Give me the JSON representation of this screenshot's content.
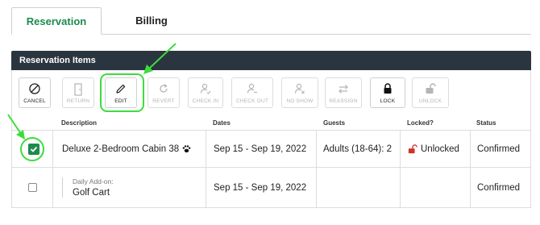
{
  "tabs": [
    {
      "label": "Reservation",
      "active": true
    },
    {
      "label": "Billing",
      "active": false
    }
  ],
  "panel": {
    "title": "Reservation Items"
  },
  "toolbar": {
    "cancel": "CANCEL",
    "return": "RETURN",
    "edit": "EDIT",
    "revert": "REVERT",
    "check_in": "CHECK IN",
    "check_out": "CHECK OUT",
    "no_show": "NO SHOW",
    "reassign": "REASSIGN",
    "lock": "LOCK",
    "unlock": "UNLOCK"
  },
  "table": {
    "headers": {
      "description": "Description",
      "dates": "Dates",
      "guests": "Guests",
      "locked": "Locked?",
      "status": "Status"
    },
    "rows": [
      {
        "checked": true,
        "description": "Deluxe 2-Bedroom Cabin 38",
        "pet_icon": "paw-icon",
        "dates": "Sep 15 - Sep 19, 2022",
        "guests": "Adults (18-64): 2",
        "locked": "Unlocked",
        "status": "Confirmed"
      },
      {
        "checked": false,
        "addon_label": "Daily Add-on:",
        "description": "Golf Cart",
        "dates": "Sep 15 - Sep 19, 2022",
        "guests": "",
        "locked": "",
        "status": "Confirmed"
      }
    ]
  },
  "colors": {
    "accent": "#1d8a4e",
    "header_bg": "#2b3540",
    "highlight": "#3ddc3d",
    "unlock_icon": "#d0332a"
  }
}
